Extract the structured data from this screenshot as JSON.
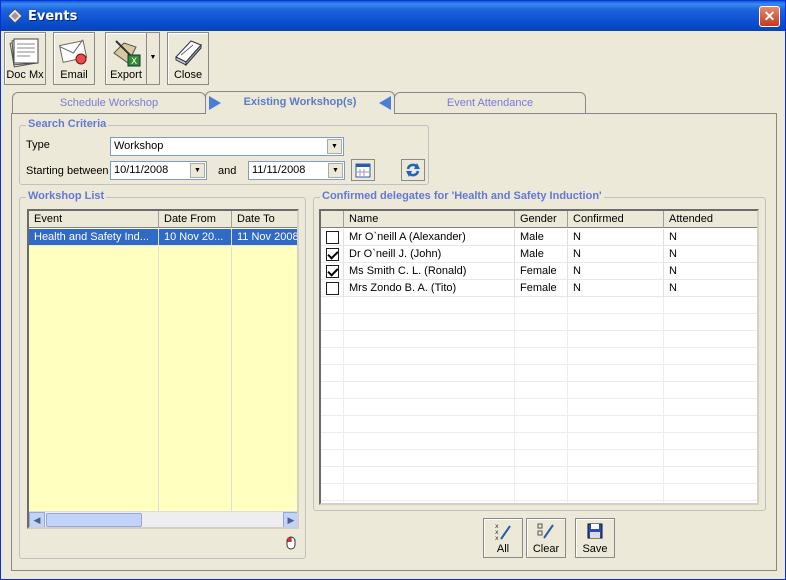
{
  "window": {
    "title": "Events"
  },
  "toolbar": {
    "docmx_label": "Doc Mx",
    "email_label": "Email",
    "export_label": "Export",
    "close_label": "Close"
  },
  "tabs": [
    {
      "label": "Schedule Workshop"
    },
    {
      "label": "Existing Workshop(s)"
    },
    {
      "label": "Event Attendance"
    }
  ],
  "search": {
    "title": "Search Criteria",
    "type_label": "Type",
    "type_value": "Workshop",
    "starting_label": "Starting between",
    "from_date": "10/11/2008",
    "and_label": "and",
    "to_date": "11/11/2008"
  },
  "workshop_list": {
    "title": "Workshop List",
    "columns": [
      "Event",
      "Date From",
      "Date To"
    ],
    "rows": [
      {
        "event": "Health and Safety Ind...",
        "date_from": "10 Nov 20...",
        "date_to": "11 Nov 2008"
      }
    ]
  },
  "delegates": {
    "title": "Confirmed delegates for 'Health and Safety Induction'",
    "columns": [
      "Name",
      "Gender",
      "Confirmed",
      "Attended"
    ],
    "rows": [
      {
        "checked": false,
        "name": "Mr O`neill A (Alexander)",
        "gender": "Male",
        "confirmed": "N",
        "attended": "N"
      },
      {
        "checked": true,
        "name": "Dr O`neill J. (John)",
        "gender": "Male",
        "confirmed": "N",
        "attended": "N"
      },
      {
        "checked": true,
        "name": "Ms Smith C. L. (Ronald)",
        "gender": "Female",
        "confirmed": "N",
        "attended": "N"
      },
      {
        "checked": false,
        "name": "Mrs Zondo B. A. (Tito)",
        "gender": "Female",
        "confirmed": "N",
        "attended": "N"
      }
    ]
  },
  "actions": {
    "all_label": "All",
    "clear_label": "Clear",
    "save_label": "Save"
  }
}
